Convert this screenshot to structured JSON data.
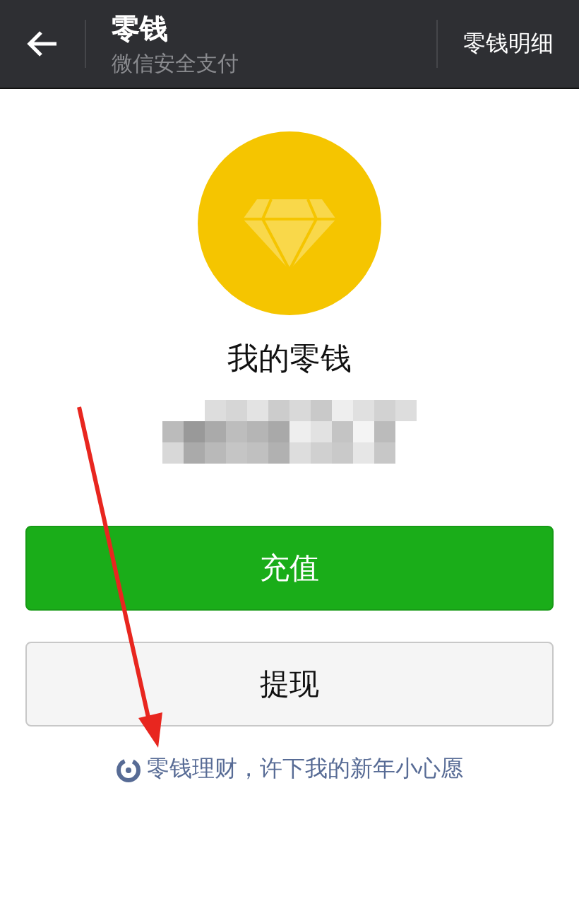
{
  "header": {
    "title": "零钱",
    "subtitle": "微信安全支付",
    "action": "零钱明细"
  },
  "balance_label": "我的零钱",
  "buttons": [
    {
      "label": "充值",
      "kind": "primary"
    },
    {
      "label": "提现",
      "kind": "secondary"
    }
  ],
  "promo_link": "零钱理财，许下我的新年小心愿"
}
